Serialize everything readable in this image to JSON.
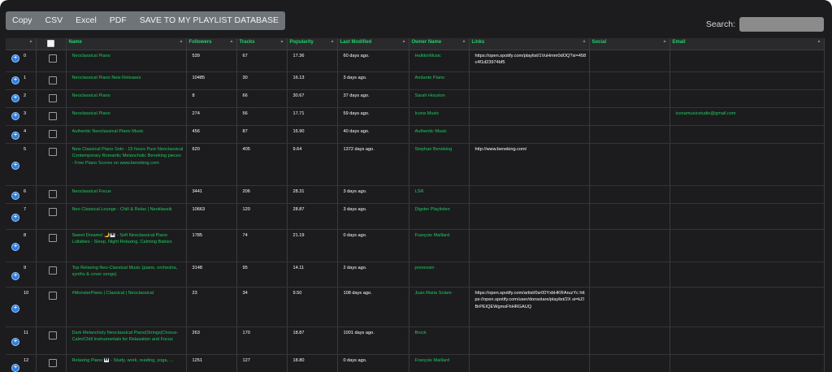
{
  "toolbar": {
    "buttons": [
      "Copy",
      "CSV",
      "Excel",
      "PDF",
      "SAVE TO MY PLAYLIST DATABASE"
    ]
  },
  "search": {
    "label": "Search:",
    "value": ""
  },
  "table": {
    "headers": [
      "Name",
      "Followers",
      "Tracks",
      "Popularity",
      "Last Modified",
      "Owner Name",
      "Links",
      "Social",
      "Email"
    ],
    "rows": [
      {
        "index": "0",
        "name": "Neoclassical Piano",
        "followers": "539",
        "tracks": "67",
        "popularity": "17.36",
        "modified": "60 days ago.",
        "owner": "HalldorMusic",
        "links": "https://open.spotify.com/playlist/1VuHmm0dOQ?si=458c4f1d23974bf5",
        "social": "",
        "email": ""
      },
      {
        "index": "1",
        "name": "Neoclassical Piano New Releases",
        "followers": "10485",
        "tracks": "30",
        "popularity": "16.13",
        "modified": "3 days ago.",
        "owner": "Andante Piano",
        "links": "",
        "social": "",
        "email": ""
      },
      {
        "index": "2",
        "name": "Neoclassical Piano",
        "followers": "8",
        "tracks": "66",
        "popularity": "30.67",
        "modified": "37 days ago.",
        "owner": "Sarah Houston",
        "links": "",
        "social": "",
        "email": ""
      },
      {
        "index": "3",
        "name": "Neoclassical Piano",
        "followers": "274",
        "tracks": "56",
        "popularity": "17.71",
        "modified": "59 days ago.",
        "owner": "Icona Music",
        "links": "",
        "social": "",
        "email": "iconamusicstudio@gmail.com"
      },
      {
        "index": "4",
        "name": "Authentic Neoclassical Piano Music",
        "followers": "456",
        "tracks": "87",
        "popularity": "16.90",
        "modified": "40 days ago.",
        "owner": "Authentic Music",
        "links": "",
        "social": "",
        "email": ""
      },
      {
        "index": "5",
        "name": "New Classical Piano Solo - 15 hours Pure Neoclassical Contemporary Romantic Melancholic Beneking pieces - Free Piano Scores on www.beneking.com",
        "followers": "620",
        "tracks": "405",
        "popularity": "9.64",
        "modified": "1372 days ago.",
        "owner": "Stephan Beneking",
        "links": "http://www.beneking.com/",
        "social": "",
        "email": ""
      },
      {
        "index": "6",
        "name": "Neoclassical Focus",
        "followers": "3441",
        "tracks": "206",
        "popularity": "28.31",
        "modified": "3 days ago.",
        "owner": "LSR",
        "links": "",
        "social": "",
        "email": ""
      },
      {
        "index": "7",
        "name": "Neo Classical Lounge - Chill & Relax | Neoklassik",
        "followers": "10663",
        "tracks": "120",
        "popularity": "28.87",
        "modified": "3 days ago.",
        "owner": "Digster Playlisten",
        "links": "",
        "social": "",
        "email": ""
      },
      {
        "index": "8",
        "name": "Sweet Dreams! 🌙🎹 - Soft Neoclassical Piano Lullabies - Sleep, Night Relaxing, Calming Babies",
        "followers": "1785",
        "tracks": "74",
        "popularity": "21.19",
        "modified": "0 days ago.",
        "owner": "François Maillard",
        "links": "",
        "social": "",
        "email": ""
      },
      {
        "index": "9",
        "name": "Top Relaxing Neo-Classical Music (piano, orchestra, synths & cover songs)",
        "followers": "3148",
        "tracks": "95",
        "popularity": "14.11",
        "modified": "2 days ago.",
        "owner": "prevessin",
        "links": "",
        "social": "",
        "email": ""
      },
      {
        "index": "10",
        "name": "#MonsterPiano | Classical | Neoclassical",
        "followers": "23",
        "tracks": "34",
        "popularity": "9.50",
        "modified": "108 days ago.",
        "owner": "Juan Maria Solare",
        "links": "https://open.spotify.com/artist/0sr00YxbHKRAruzYc https://open.spotify.com/user/donsolare/playlist/2X si=kZlBrPEIQEWgmsFhHRGAUQ",
        "social": "",
        "email": ""
      },
      {
        "index": "11",
        "name": "Dark Melancholy Neoclassical Piano|Strings|Chorus- Calm/Chill Instrumentals for Relaxation and Focus",
        "followers": "263",
        "tracks": "170",
        "popularity": "18.87",
        "modified": "1001 days ago.",
        "owner": "Brock",
        "links": "",
        "social": "",
        "email": ""
      },
      {
        "index": "12",
        "name": "Relaxing Piano 🎹 - Study, work, reading, yoga, ...",
        "followers": "1251",
        "tracks": "127",
        "popularity": "18.80",
        "modified": "0 days ago.",
        "owner": "François Maillard",
        "links": "",
        "social": "",
        "email": ""
      }
    ]
  }
}
